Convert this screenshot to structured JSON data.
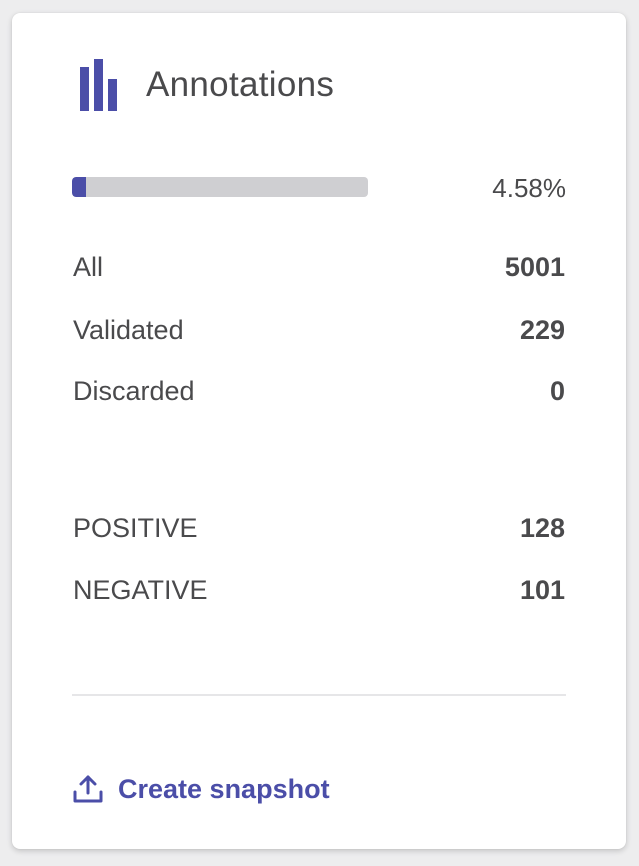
{
  "card": {
    "title": "Annotations",
    "icon": "bar-chart-icon",
    "accent_color": "#4b4ea8"
  },
  "progress": {
    "percent": 4.58,
    "label": "4.58%"
  },
  "stats": [
    {
      "label": "All",
      "value": "5001"
    },
    {
      "label": "Validated",
      "value": "229"
    },
    {
      "label": "Discarded",
      "value": "0"
    }
  ],
  "labels": [
    {
      "label": "POSITIVE",
      "value": "128"
    },
    {
      "label": "NEGATIVE",
      "value": "101"
    }
  ],
  "actions": {
    "snapshot_label": "Create snapshot",
    "snapshot_icon": "upload-icon"
  }
}
